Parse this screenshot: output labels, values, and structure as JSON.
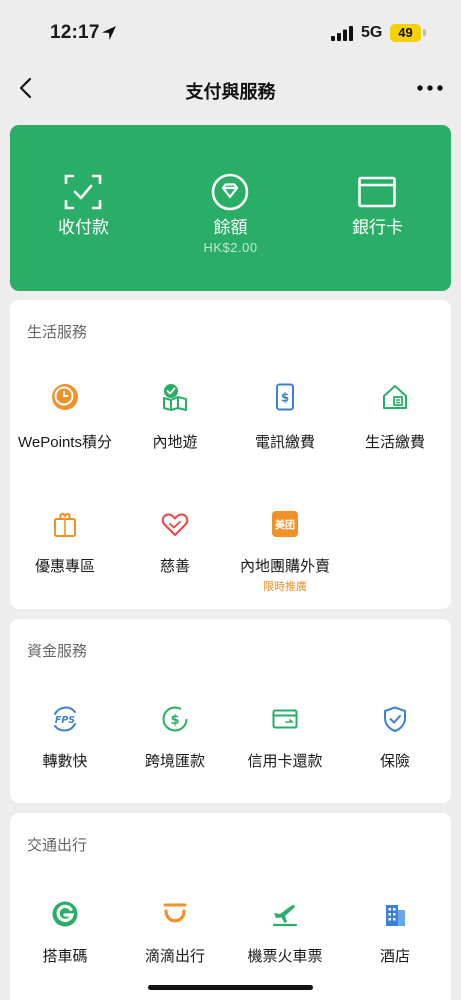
{
  "status": {
    "time": "12:17",
    "network": "5G",
    "battery": "49"
  },
  "nav": {
    "title": "支付與服務"
  },
  "wallet": {
    "collect_label": "收付款",
    "balance_label": "餘額",
    "balance_value": "HK$2.00",
    "bank_card_label": "銀行卡"
  },
  "life": {
    "title": "生活服務",
    "items": [
      {
        "label": "WePoints積分",
        "icon": "wepoints-coin-icon"
      },
      {
        "label": "內地遊",
        "icon": "mainland-travel-icon"
      },
      {
        "label": "電訊繳費",
        "icon": "mobile-topup-icon"
      },
      {
        "label": "生活繳費",
        "icon": "utility-bill-icon"
      },
      {
        "label": "優惠專區",
        "icon": "offers-bag-icon"
      },
      {
        "label": "慈善",
        "icon": "charity-heart-icon"
      },
      {
        "label": "內地團購外賣",
        "icon": "meituan-icon",
        "badge_text": "美团",
        "promo": "限時推廣"
      }
    ]
  },
  "finance": {
    "title": "資金服務",
    "items": [
      {
        "label": "轉數快",
        "icon": "fps-icon",
        "badge_text": "FPS"
      },
      {
        "label": "跨境匯款",
        "icon": "cross-border-remit-icon"
      },
      {
        "label": "信用卡還款",
        "icon": "credit-card-repay-icon"
      },
      {
        "label": "保險",
        "icon": "insurance-shield-icon"
      }
    ]
  },
  "transport": {
    "title": "交通出行",
    "items": [
      {
        "label": "搭車碼",
        "icon": "ride-code-icon"
      },
      {
        "label": "滴滴出行",
        "icon": "didi-icon"
      },
      {
        "label": "機票火車票",
        "icon": "plane-train-icon"
      },
      {
        "label": "酒店",
        "icon": "hotel-icon"
      }
    ]
  },
  "colors": {
    "wechat_green": "#2aae67",
    "orange": "#f0912a",
    "red": "#e84545",
    "blue": "#3b82d6",
    "promo": "#e8902b"
  }
}
